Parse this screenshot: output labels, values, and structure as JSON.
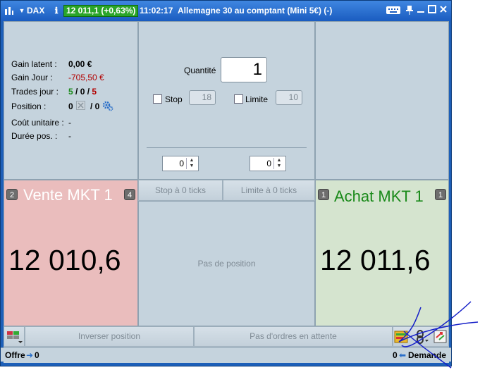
{
  "titlebar": {
    "instrument": "DAX",
    "price_badge": "12 011,1 (+0,63%)",
    "time": "11:02:17",
    "description": "Allemagne 30 au comptant (Mini 5€) (-)"
  },
  "stats": {
    "gain_latent_label": "Gain latent :",
    "gain_latent_value": "0,00 €",
    "gain_jour_label": "Gain Jour :",
    "gain_jour_value": "-705,50 €",
    "trades_label": "Trades jour :",
    "trades_a": "5",
    "trades_sep1": " / ",
    "trades_b": "0",
    "trades_sep2": " / ",
    "trades_c": "5",
    "position_label": "Position :",
    "position_value": "0",
    "position_sep": "/ 0",
    "cout_label": "Coût unitaire :",
    "cout_value": "-",
    "duree_label": "Durée pos. :",
    "duree_value": "-"
  },
  "order": {
    "quantite_label": "Quantité",
    "quantite_value": "1",
    "stop_label": "Stop",
    "stop_value": "18",
    "limite_label": "Limite",
    "limite_value": "10",
    "spin_left_value": "0",
    "spin_right_value": "0"
  },
  "sell": {
    "badge_left": "2",
    "label": "Vente MKT 1",
    "badge_right": "4",
    "price": "12 010,6"
  },
  "buy": {
    "badge_left": "1",
    "label": "Achat MKT 1",
    "badge_right": "1",
    "price": "12 011,6"
  },
  "middle": {
    "stop_ticks": "Stop à 0 ticks",
    "limite_ticks": "Limite à 0 ticks",
    "no_position": "Pas de position"
  },
  "bottom": {
    "inverser": "Inverser position",
    "no_orders": "Pas d'ordres en attente"
  },
  "statusbar": {
    "offre_label": "Offre",
    "offre_value": "0",
    "demande_value": "0",
    "demande_label": "Demande"
  },
  "colors": {
    "sell_bg": "#eabdbd",
    "buy_bg": "#d5e4cf",
    "buy_label": "#1a8a1a",
    "sell_label": "#ffffff",
    "gain_negative": "#b20000",
    "trades_win": "#1a8a1a"
  }
}
